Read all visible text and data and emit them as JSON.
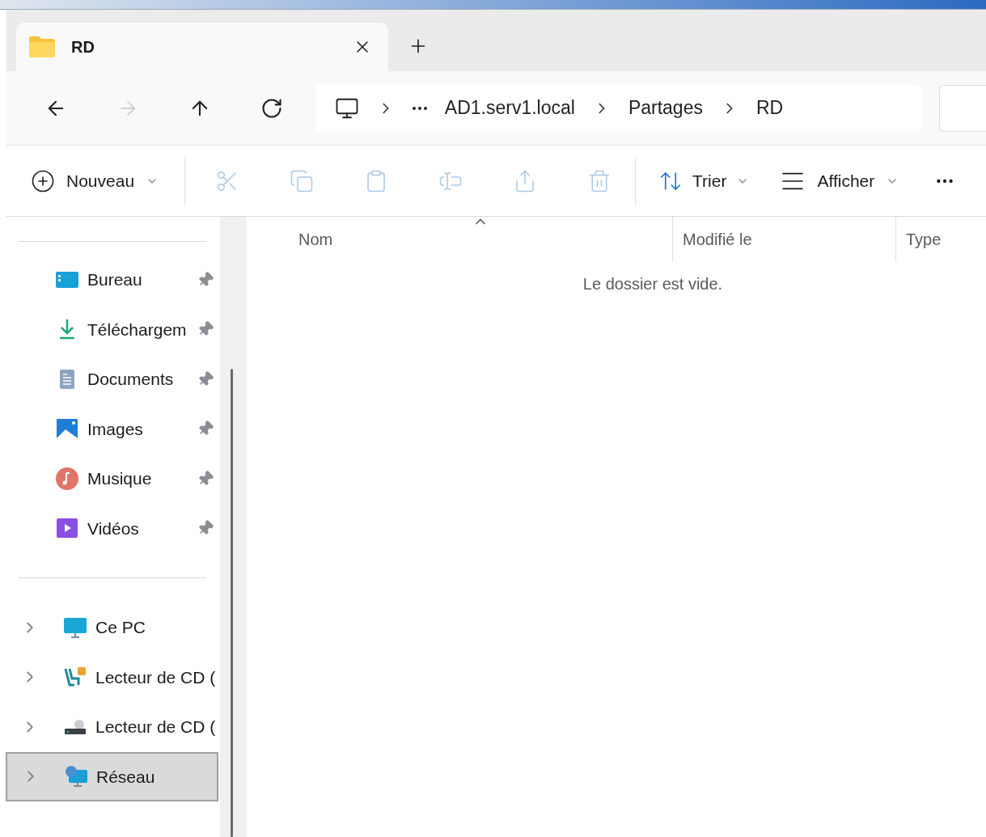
{
  "tabs": [
    {
      "label": "RD",
      "selected": true
    }
  ],
  "nav": [
    {
      "kind": "back",
      "disabled": false
    },
    {
      "kind": "forward",
      "disabled": true
    },
    {
      "kind": "up",
      "disabled": false
    },
    {
      "kind": "refresh",
      "disabled": false
    }
  ],
  "breadcrumb": [
    "AD1.serv1.local",
    "Partages",
    "RD"
  ],
  "toolbar": {
    "new": {
      "label": "Nouveau"
    },
    "actions": [
      {
        "kind": "cut",
        "disabled": true
      },
      {
        "kind": "copy",
        "disabled": true
      },
      {
        "kind": "paste",
        "disabled": true
      },
      {
        "kind": "rename",
        "disabled": true
      },
      {
        "kind": "share",
        "disabled": true
      },
      {
        "kind": "delete",
        "disabled": true
      }
    ],
    "sort": {
      "label": "Trier"
    },
    "view": {
      "label": "Afficher"
    }
  },
  "columns": [
    {
      "label": "Nom",
      "sorted": true
    },
    {
      "label": "Modifié le",
      "sorted": false
    },
    {
      "label": "Type",
      "sorted": false
    }
  ],
  "empty_message": "Le dossier est vide.",
  "quick_access": [
    {
      "label": "Bureau",
      "kind": "desktop",
      "pinned": true
    },
    {
      "label": "Téléchargem",
      "kind": "downloads",
      "pinned": true
    },
    {
      "label": "Documents",
      "kind": "documents",
      "pinned": true
    },
    {
      "label": "Images",
      "kind": "pictures",
      "pinned": true
    },
    {
      "label": "Musique",
      "kind": "music",
      "pinned": true
    },
    {
      "label": "Vidéos",
      "kind": "videos",
      "pinned": true
    }
  ],
  "locations": [
    {
      "label": "Ce PC",
      "kind": "pc",
      "selected": false
    },
    {
      "label": "Lecteur de CD (",
      "kind": "dvd",
      "selected": false
    },
    {
      "label": "Lecteur de CD (",
      "kind": "cd",
      "selected": false
    },
    {
      "label": "Réseau",
      "kind": "network",
      "selected": true
    }
  ]
}
